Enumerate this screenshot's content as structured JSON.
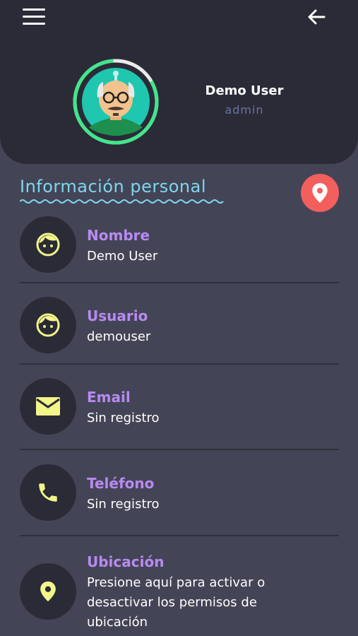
{
  "header": {
    "user_name": "Demo User",
    "user_role": "admin"
  },
  "section": {
    "title": "Información personal"
  },
  "fields": [
    {
      "label": "Nombre",
      "value": "Demo User",
      "icon": "face-icon"
    },
    {
      "label": "Usuario",
      "value": "demouser",
      "icon": "face-icon"
    },
    {
      "label": "Email",
      "value": "Sin registro",
      "icon": "mail-icon"
    },
    {
      "label": "Teléfono",
      "value": "Sin registro",
      "icon": "phone-icon"
    },
    {
      "label": "Ubicación",
      "value": "Presione aquí para activar o desactivar los permisos de ubicación",
      "icon": "location-pin-icon"
    }
  ],
  "colors": {
    "background": "#434556",
    "header": "#2a2b37",
    "label": "#b88af0",
    "section_title": "#7fd6ee",
    "icon": "#f2f58a",
    "fab": "#f25f5c",
    "avatar_ring": "#41e68a"
  }
}
